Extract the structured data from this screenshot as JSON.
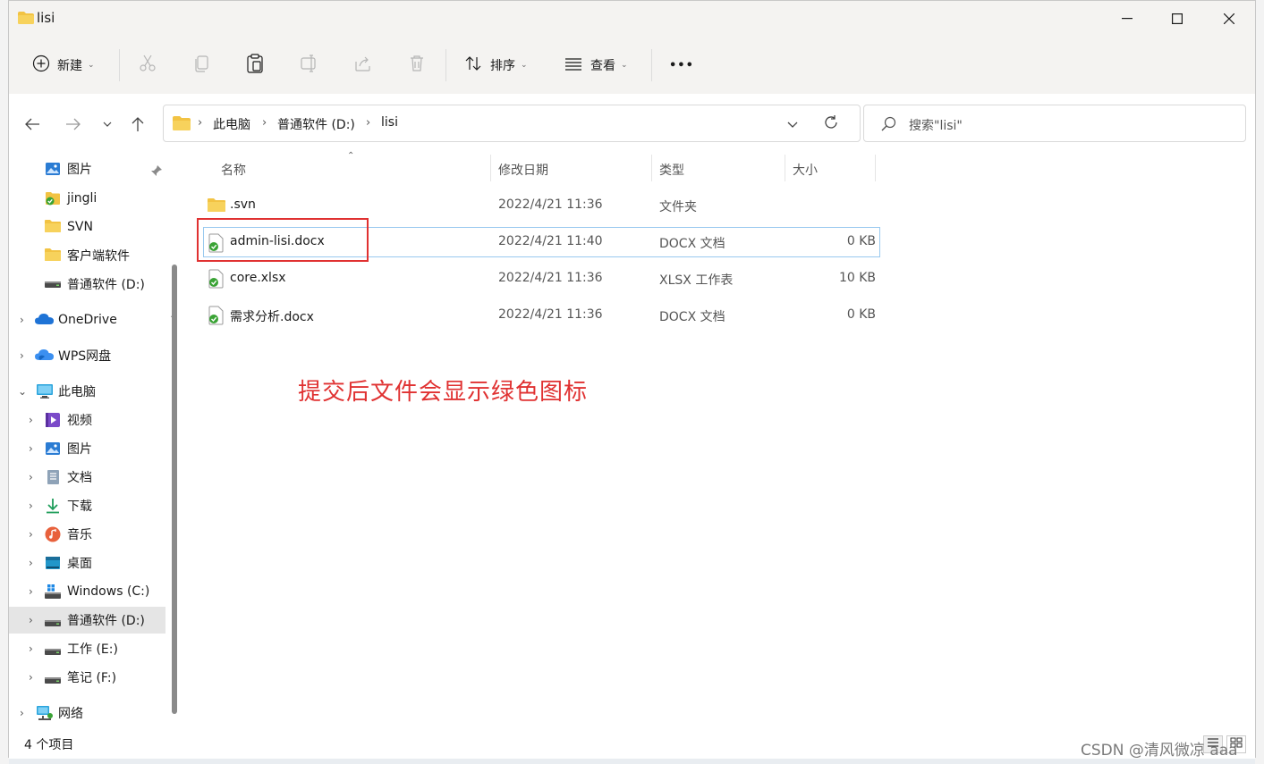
{
  "window": {
    "title": "lisi"
  },
  "toolbar": {
    "new_label": "新建",
    "sort_label": "排序",
    "view_label": "查看",
    "more_label": "•••"
  },
  "breadcrumb": [
    "此电脑",
    "普通软件 (D:)",
    "lisi"
  ],
  "search": {
    "placeholder": "搜索\"lisi\""
  },
  "sidebar": {
    "quick": [
      {
        "label": "图片",
        "icon": "pictures-icon"
      },
      {
        "label": "jingli",
        "icon": "svn-folder-icon"
      },
      {
        "label": "SVN",
        "icon": "folder-icon"
      },
      {
        "label": "客户端软件",
        "icon": "folder-icon"
      },
      {
        "label": "普通软件 (D:)",
        "icon": "drive-icon"
      }
    ],
    "onedrive": "OneDrive",
    "wps": "WPS网盘",
    "thispc": "此电脑",
    "pc_items": [
      {
        "label": "视频",
        "icon": "video-icon"
      },
      {
        "label": "图片",
        "icon": "pictures-icon"
      },
      {
        "label": "文档",
        "icon": "documents-icon"
      },
      {
        "label": "下载",
        "icon": "download-icon"
      },
      {
        "label": "音乐",
        "icon": "music-icon"
      },
      {
        "label": "桌面",
        "icon": "desktop-icon"
      },
      {
        "label": "Windows (C:)",
        "icon": "windows-drive-icon"
      },
      {
        "label": "普通软件 (D:)",
        "icon": "drive-icon"
      },
      {
        "label": "工作 (E:)",
        "icon": "drive-icon"
      },
      {
        "label": "笔记 (F:)",
        "icon": "drive-icon"
      }
    ],
    "network": "网络"
  },
  "columns": {
    "name": "名称",
    "modified": "修改日期",
    "type": "类型",
    "size": "大小"
  },
  "files": [
    {
      "name": ".svn",
      "modified": "2022/4/21 11:36",
      "type": "文件夹",
      "size": "",
      "icon": "folder-icon"
    },
    {
      "name": "admin-lisi.docx",
      "modified": "2022/4/21 11:40",
      "type": "DOCX 文档",
      "size": "0 KB",
      "icon": "svn-green-file-icon"
    },
    {
      "name": "core.xlsx",
      "modified": "2022/4/21 11:36",
      "type": "XLSX 工作表",
      "size": "10 KB",
      "icon": "svn-green-file-icon"
    },
    {
      "name": "需求分析.docx",
      "modified": "2022/4/21 11:36",
      "type": "DOCX 文档",
      "size": "0 KB",
      "icon": "svn-green-file-icon"
    }
  ],
  "annotation": "提交后文件会显示绿色图标",
  "status": {
    "count": "4 个项目"
  },
  "watermark": "CSDN @清风微凉 aaa",
  "colors": {
    "annotation": "#e03131",
    "selection_border": "#99c9ef",
    "svn_green": "#3aa335",
    "folder": "#f2c343"
  }
}
